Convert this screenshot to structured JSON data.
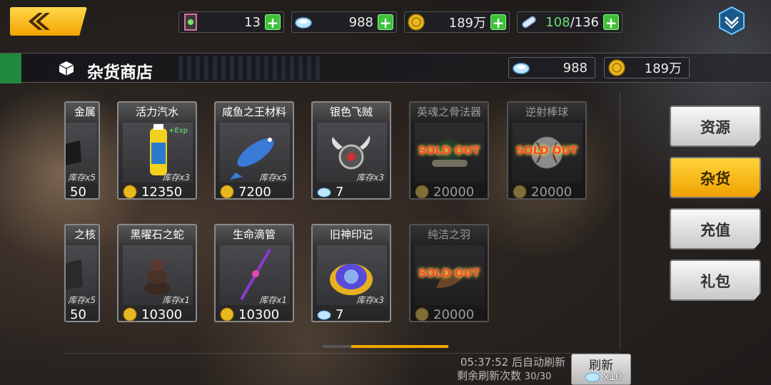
{
  "topbar": {
    "ticket": {
      "value": "13"
    },
    "diamond": {
      "value": "988"
    },
    "gold": {
      "value": "189万"
    },
    "stamina": {
      "current": "108",
      "sep": "/",
      "max": "136"
    }
  },
  "shop": {
    "title": "杂货商店",
    "diamond": "988",
    "gold": "189万"
  },
  "items_row1": [
    {
      "name": "金属",
      "stock": "库存x5",
      "price": "50",
      "currency": "gold",
      "sold_out": false
    },
    {
      "name": "活力汽水",
      "stock": "库存x3",
      "price": "12350",
      "currency": "gold",
      "sold_out": false,
      "tag": "+Exp"
    },
    {
      "name": "咸鱼之王材料",
      "stock": "库存x5",
      "price": "7200",
      "currency": "gold",
      "sold_out": false
    },
    {
      "name": "银色飞贼",
      "stock": "库存x3",
      "price": "7",
      "currency": "diamond",
      "sold_out": false
    },
    {
      "name": "英魂之骨法器",
      "stock": "",
      "price": "20000",
      "currency": "gold",
      "sold_out": true
    },
    {
      "name": "逆射棒球",
      "stock": "",
      "price": "20000",
      "currency": "gold",
      "sold_out": true
    }
  ],
  "items_row2": [
    {
      "name": "之核",
      "stock": "库存x5",
      "price": "50",
      "currency": "gold",
      "sold_out": false
    },
    {
      "name": "黑曜石之蛇",
      "stock": "库存x1",
      "price": "10300",
      "currency": "gold",
      "sold_out": false
    },
    {
      "name": "生命滴管",
      "stock": "库存x1",
      "price": "10300",
      "currency": "gold",
      "sold_out": false
    },
    {
      "name": "旧神印记",
      "stock": "库存x3",
      "price": "7",
      "currency": "diamond",
      "sold_out": false
    },
    {
      "name": "纯洁之羽",
      "stock": "",
      "price": "20000",
      "currency": "gold",
      "sold_out": true
    }
  ],
  "sold_out_label": "SOLD OUT",
  "tabs": [
    {
      "label": "资源",
      "active": false
    },
    {
      "label": "杂货",
      "active": true
    },
    {
      "label": "充值",
      "active": false
    },
    {
      "label": "礼包",
      "active": false
    }
  ],
  "refresh": {
    "timer_text": "05:37:52 后自动刷新",
    "remaining_label": "剩余刷新次数",
    "remaining_count": "30/30",
    "button_label": "刷新",
    "cost": "x10"
  },
  "colors": {
    "accent": "#f0a800",
    "green": "#3fbf3a",
    "soldout": "#ff4a2a"
  }
}
